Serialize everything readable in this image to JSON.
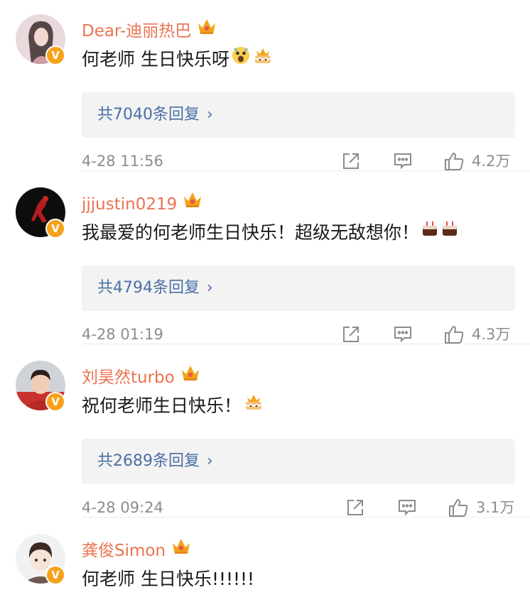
{
  "comments": [
    {
      "username": "Dear-迪丽热巴",
      "text": "何老师 生日快乐呀",
      "emojis": [
        "astonished-face-icon",
        "birthday-cake-icon"
      ],
      "replies": "共7040条回复",
      "time": "4-28 11:56",
      "likes": "4.2万",
      "verified": "V"
    },
    {
      "username": "jjjustin0219",
      "text": "我最爱的何老师生日快乐！超级无敌想你！",
      "emojis": [
        "cake-icon",
        "cake-icon"
      ],
      "replies": "共4794条回复",
      "time": "4-28 01:19",
      "likes": "4.3万",
      "verified": "V"
    },
    {
      "username": "刘昊然turbo",
      "text": "祝何老师生日快乐！",
      "emojis": [
        "birthday-cake-icon"
      ],
      "replies": "共2689条回复",
      "time": "4-28 09:24",
      "likes": "3.1万",
      "verified": "V"
    },
    {
      "username": "龚俊Simon",
      "text": "何老师 生日快乐!!!!!!",
      "emojis": [],
      "verified": "V"
    }
  ],
  "colors": {
    "username": "#eb7350",
    "reply_link": "#4a6fa5",
    "meta": "#8c8c8c",
    "crown": "#f3a31b",
    "verified_badge": "#f7a11b"
  }
}
